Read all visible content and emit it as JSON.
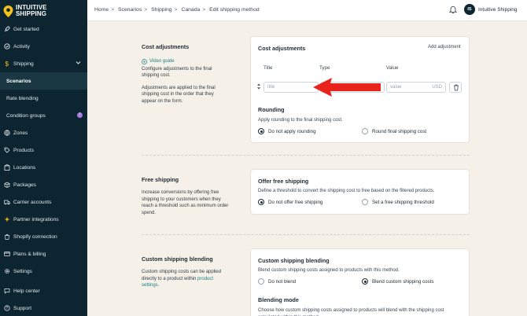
{
  "app": {
    "logo_line1": "INTUITIVE",
    "logo_line2": "SHIPPING"
  },
  "sidebar": {
    "items": [
      {
        "label": "Get started",
        "icon": "rocket-icon"
      },
      {
        "label": "Activity",
        "icon": "activity-icon"
      },
      {
        "label": "Shipping",
        "icon": "dollar-icon"
      },
      {
        "label": "Scenarios"
      },
      {
        "label": "Rate blending"
      },
      {
        "label": "Condition groups",
        "badge": "!"
      },
      {
        "label": "Zones",
        "icon": "globe-icon"
      },
      {
        "label": "Products",
        "icon": "tag-icon"
      },
      {
        "label": "Locations",
        "icon": "building-icon"
      },
      {
        "label": "Packages",
        "icon": "box-icon"
      },
      {
        "label": "Carrier accounts",
        "icon": "truck-icon"
      },
      {
        "label": "Partner integrations",
        "icon": "sparkle-icon"
      },
      {
        "label": "Shopify connection",
        "icon": "shopify-icon"
      },
      {
        "label": "Plans & billing",
        "icon": "card-icon"
      },
      {
        "label": "Settings",
        "icon": "gear-icon"
      },
      {
        "label": "Help center",
        "icon": "chat-icon"
      },
      {
        "label": "Support",
        "icon": "help-icon"
      }
    ]
  },
  "topbar": {
    "breadcrumb": [
      "Home",
      "Scenarios",
      "Shipping",
      "Canada",
      "Edit shipping method"
    ],
    "avatar_initials": "IS",
    "user_name": "Intuitive Shipping"
  },
  "cost_adjustments": {
    "left_title": "Cost adjustments",
    "video_link": "Video guide",
    "left_text1": "Configure adjustments to the final shipping cost.",
    "left_text2": "Adjustments are applied to the final shipping cost in the order that they appear on the form.",
    "card_title": "Cost adjustments",
    "add_link": "Add adjustment",
    "col_title": "Title",
    "col_type": "Type",
    "col_value": "Value",
    "title_placeholder": "title",
    "value_placeholder": "value",
    "currency": "USD",
    "rounding_title": "Rounding",
    "rounding_sub": "Apply rounding to the final shipping cost.",
    "rounding_opt1": "Do not apply rounding",
    "rounding_opt2": "Round final shipping cost"
  },
  "free_shipping": {
    "left_title": "Free shipping",
    "left_text": "Increase conversions by offering free shipping to your customers when they reach a threshold such as minimum order spend.",
    "card_title": "Offer free shipping",
    "card_sub": "Define a threshold to convert the shipping cost to free based on the filtered products.",
    "opt1": "Do not offer free shipping",
    "opt2": "Set a free shipping threshold"
  },
  "blending": {
    "left_title": "Custom shipping blending",
    "left_text": "Custom shipping costs can be applied directly to a product within",
    "left_link": "product settings",
    "left_end": ".",
    "card_title": "Custom shipping blending",
    "card_sub": "Blend custom shipping costs assigned to products with this method.",
    "opt1": "Do not blend",
    "opt2": "Blend custom shipping costs",
    "mode_title": "Blending mode",
    "mode_sub": "Choose how custom shipping costs assigned to products will blend with the shipping cost calculated within this method."
  },
  "colors": {
    "sidebar_bg": "#0d2530",
    "page_bg": "#f5f1e8",
    "accent_link": "#1a7f84",
    "arrow": "#e8231b"
  }
}
